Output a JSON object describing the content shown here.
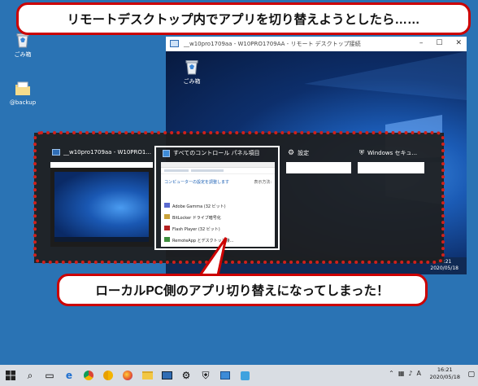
{
  "callout_top": "リモートデスクトップ内でアプリを切り替えようとしたら……",
  "callout_bottom": "ローカルPC側のアプリ切り替えになってしまった！",
  "desktop": {
    "icons": [
      {
        "label": "ごみ箱",
        "icon": "recycle-bin-icon"
      },
      {
        "label": "@backup",
        "icon": "folder-icon"
      }
    ]
  },
  "remote_window": {
    "title": "__w10pro1709aa - W10PRO1709AA - リモート デスクトップ接続",
    "desktop_icon_label": "ごみ箱",
    "clock_time": "16:21",
    "clock_date": "2020/05/18"
  },
  "switcher": {
    "items": [
      {
        "title": "__w10pro1709aa - W10PRO1...",
        "icon": "remote-desktop-icon"
      },
      {
        "title": "すべてのコントロール パネル項目",
        "icon": "control-panel-icon"
      },
      {
        "title": "設定",
        "icon": "gear-icon"
      },
      {
        "title": "Windows セキュ...",
        "icon": "shield-icon"
      }
    ],
    "control_panel": {
      "link": "コンピューターの設定を調整します",
      "view": "表示方法:",
      "items": [
        "Adobe Gamma (32 ビット)",
        "BitLocker ドライブ暗号化",
        "Flash Player (32 ビット)",
        "RemoteApp とデスクトップ接..."
      ]
    }
  },
  "taskbar": {
    "clock_time": "16:21",
    "clock_date": "2020/05/18",
    "ime": "A"
  }
}
